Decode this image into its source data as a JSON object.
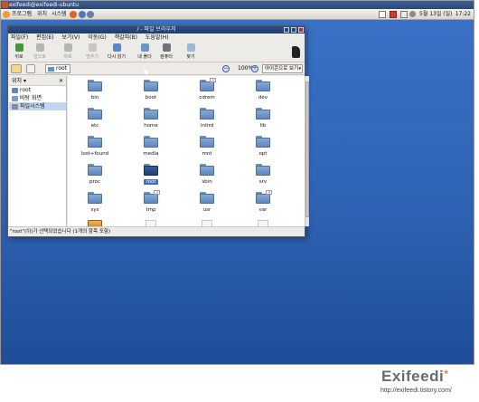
{
  "titlebar": {
    "text": "exifeedi@exifeedi-ubuntu"
  },
  "panel": {
    "menus": [
      "프로그램",
      "위치",
      "시스템"
    ],
    "date": "5월 13일 (일)",
    "clock": "17:22"
  },
  "window": {
    "title": "/ - 파일 브라우저",
    "menubar": [
      "파일(F)",
      "편집(E)",
      "보기(V)",
      "이동(G)",
      "책갈피(B)",
      "도움말(H)"
    ],
    "toolbar": [
      {
        "label": "뒤로",
        "icon": "back-arrow-icon",
        "enabled": true
      },
      {
        "label": "앞으로",
        "icon": "forward-arrow-icon",
        "enabled": false
      },
      {
        "label": "위로",
        "icon": "up-arrow-icon",
        "enabled": false
      },
      {
        "label": "멈추기",
        "icon": "stop-icon",
        "enabled": false
      },
      {
        "label": "다시 읽기",
        "icon": "reload-icon",
        "enabled": true
      },
      {
        "label": "내 폴더",
        "icon": "home-folder-icon",
        "enabled": true
      },
      {
        "label": "컴퓨터",
        "icon": "computer-icon",
        "enabled": true
      },
      {
        "label": "찾기",
        "icon": "search-icon",
        "enabled": true
      }
    ],
    "location": {
      "crumb": "root",
      "zoom": "100%",
      "view_mode": "아이콘으로 보기"
    },
    "sidebar": {
      "header": "위치 ▾",
      "items": [
        {
          "label": "root",
          "icon": "home-icon"
        },
        {
          "label": "바탕 화면",
          "icon": "desktop-icon"
        },
        {
          "label": "파일시스템",
          "icon": "drive-icon",
          "selected": true
        }
      ]
    },
    "files": [
      {
        "name": "bin"
      },
      {
        "name": "boot"
      },
      {
        "name": "cdrom",
        "link": true
      },
      {
        "name": "dev"
      },
      {
        "name": "etc"
      },
      {
        "name": "home"
      },
      {
        "name": "initrd"
      },
      {
        "name": "lib"
      },
      {
        "name": "lost+found"
      },
      {
        "name": "media"
      },
      {
        "name": "mnt"
      },
      {
        "name": "opt"
      },
      {
        "name": "proc"
      },
      {
        "name": "root",
        "selected": true
      },
      {
        "name": "sbin"
      },
      {
        "name": "srv"
      },
      {
        "name": "sys"
      },
      {
        "name": "tmp",
        "link": true
      },
      {
        "name": "usr"
      },
      {
        "name": "var",
        "link": true
      },
      {
        "name": "",
        "kind": "package"
      },
      {
        "name": "",
        "kind": "document"
      },
      {
        "name": "",
        "kind": "document"
      },
      {
        "name": "",
        "kind": "document"
      }
    ],
    "status": "\"root\"(이)가 선택되었습니다 (1개의 항목 포함)"
  },
  "watermark": {
    "logo": "Exifeedi",
    "url": "http://exifeedi.tistory.com/"
  },
  "colors": {
    "desktop": "#2f63b4",
    "selection": "#3f6fb2",
    "folder": "#5f86bd"
  }
}
